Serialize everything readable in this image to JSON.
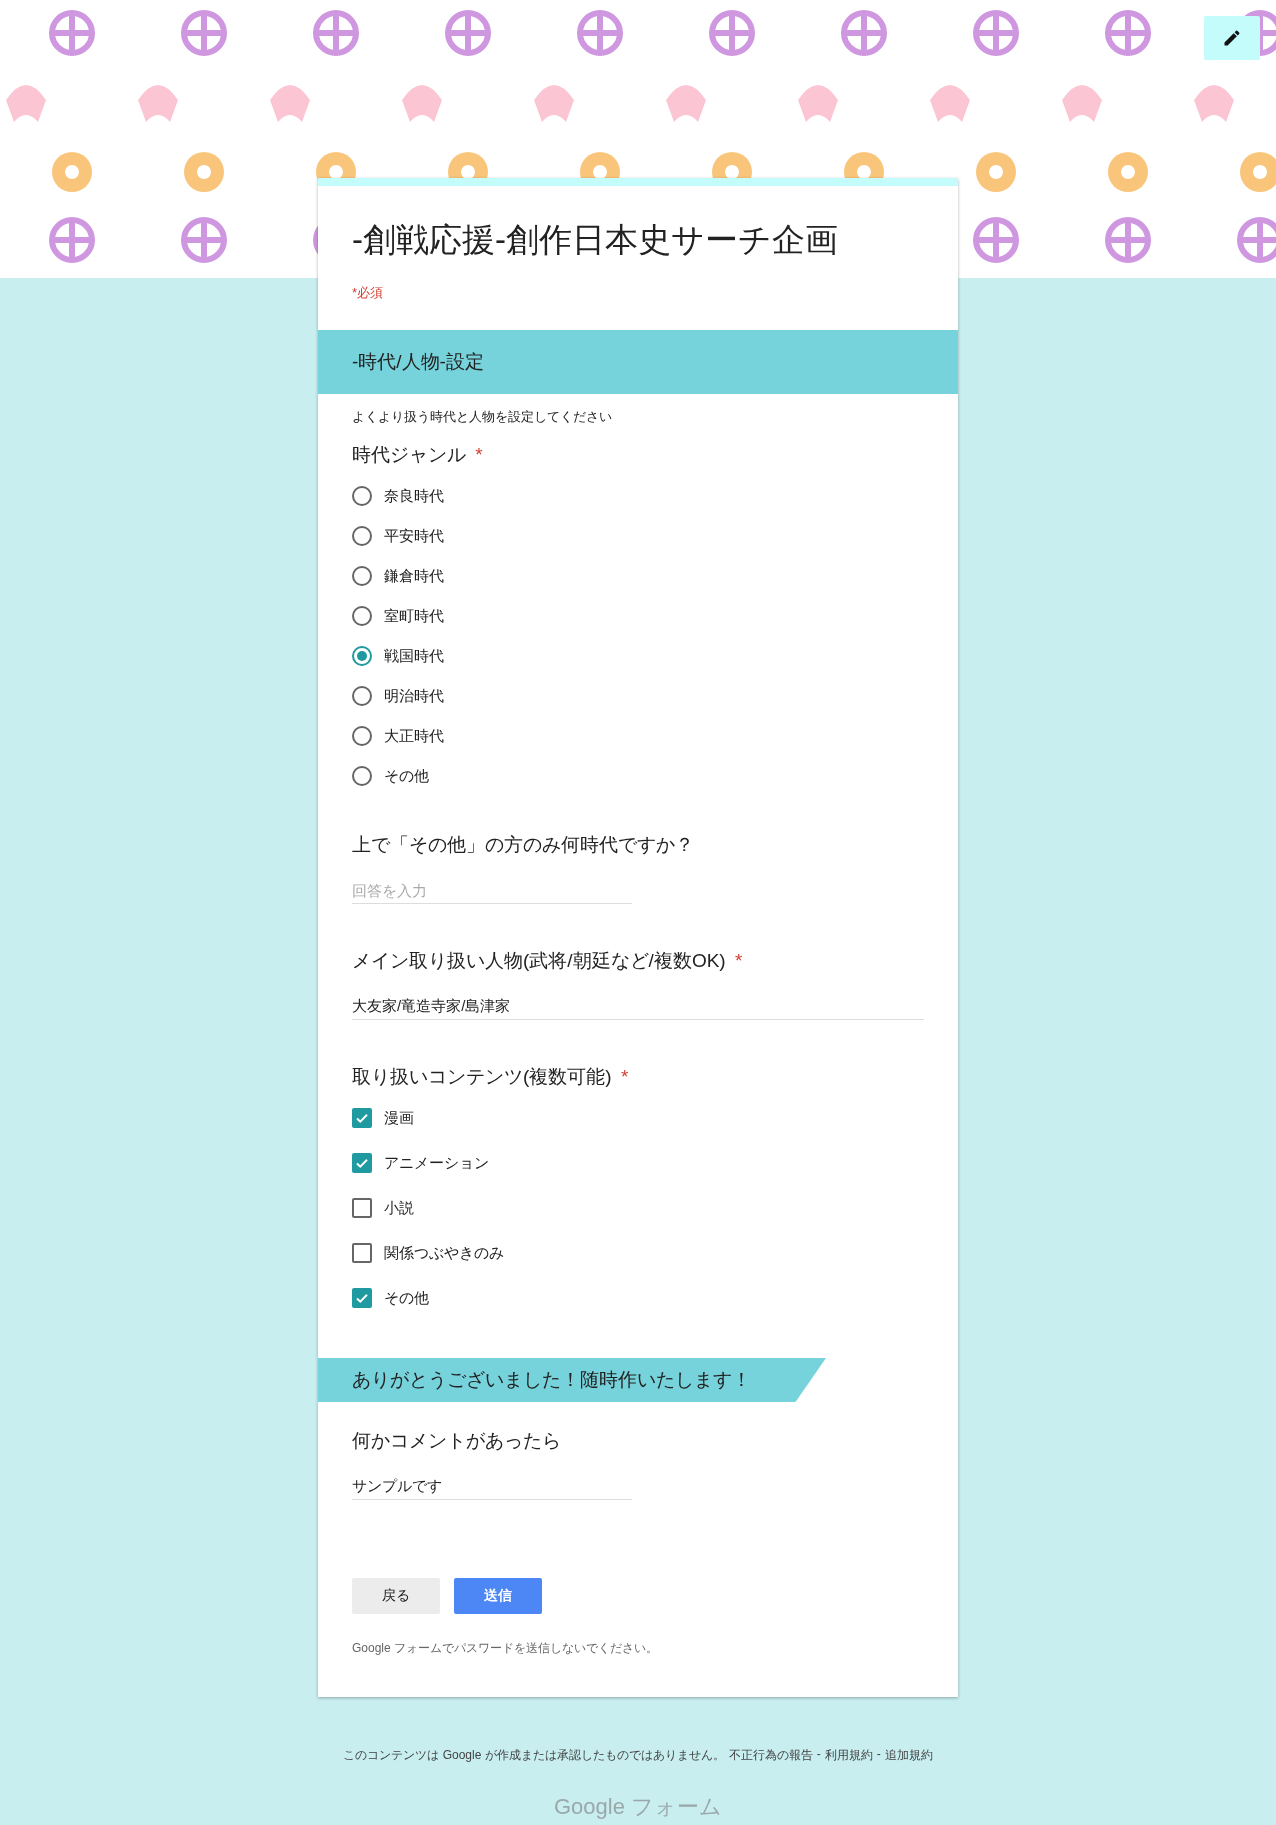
{
  "title": "-創戦応援-創作日本史サーチ企画",
  "required_note": "*必須",
  "required_mark": "*",
  "items": [
    {
      "kind": "section",
      "title": "-時代/人物-設定",
      "description": "よくより扱う時代と人物を設定してください"
    },
    {
      "kind": "radio",
      "label": "時代ジャンル",
      "required": true,
      "options": [
        {
          "label": "奈良時代",
          "selected": false
        },
        {
          "label": "平安時代",
          "selected": false
        },
        {
          "label": "鎌倉時代",
          "selected": false
        },
        {
          "label": "室町時代",
          "selected": false
        },
        {
          "label": "戦国時代",
          "selected": true
        },
        {
          "label": "明治時代",
          "selected": false
        },
        {
          "label": "大正時代",
          "selected": false
        },
        {
          "label": "その他",
          "selected": false
        }
      ]
    },
    {
      "kind": "text",
      "label": "上で「その他」の方のみ何時代ですか？",
      "required": false,
      "placeholder": "回答を入力"
    },
    {
      "kind": "paragraph",
      "label": "メイン取り扱い人物(武将/朝廷など/複数OK)",
      "required": true,
      "value": "大友家/竜造寺家/島津家"
    },
    {
      "kind": "checkbox",
      "label": "取り扱いコンテンツ(複数可能)",
      "required": true,
      "options": [
        {
          "label": "漫画",
          "checked": true
        },
        {
          "label": "アニメーション",
          "checked": true
        },
        {
          "label": "小説",
          "checked": false
        },
        {
          "label": "関係つぶやきのみ",
          "checked": false
        },
        {
          "label": "その他",
          "checked": true
        }
      ]
    },
    {
      "kind": "banner",
      "title": "ありがとうございました！随時作いたします！"
    },
    {
      "kind": "text",
      "label": "何かコメントがあったら",
      "required": false,
      "value": "サンプルです"
    }
  ],
  "buttons": [
    {
      "label": "戻る",
      "kind": "secondary"
    },
    {
      "label": "送信",
      "kind": "primary"
    }
  ],
  "password_note": "Google フォームでパスワードを送信しないでください。",
  "footer": {
    "disclaimer": "このコンテンツは Google が作成または承認したものではありません。",
    "links": [
      "不正行為の報告",
      "利用規約",
      "追加規約"
    ],
    "separator": "-",
    "logo": "Google フォーム"
  }
}
